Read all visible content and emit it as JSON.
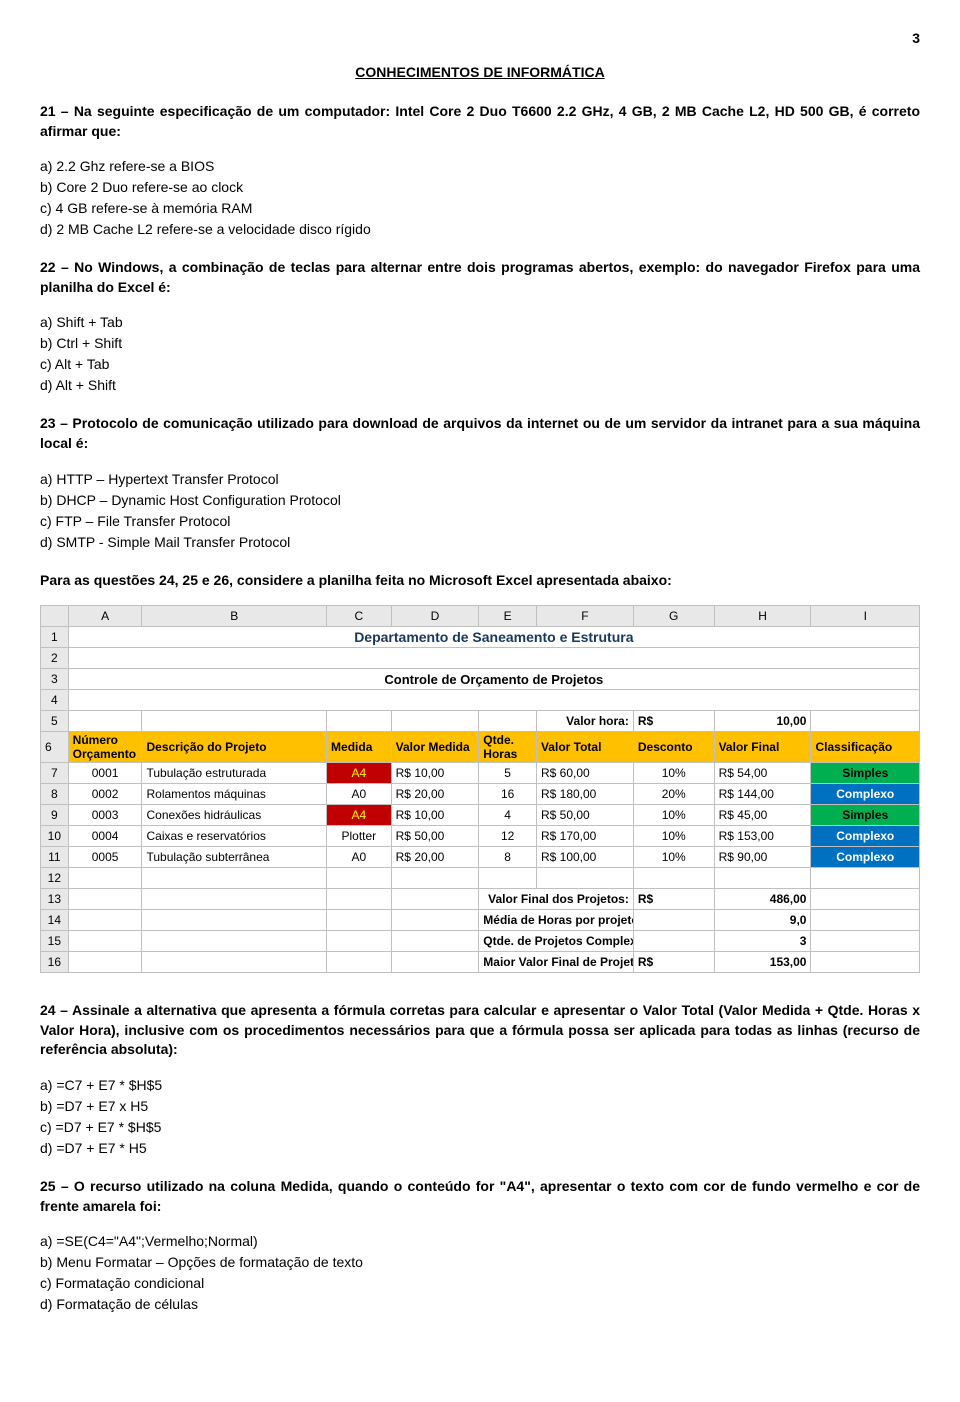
{
  "page_number": "3",
  "section_title": "CONHECIMENTOS DE INFORMÁTICA",
  "q21": {
    "stem": "21 – Na seguinte especificação de um computador: Intel Core 2 Duo T6600 2.2 GHz,  4 GB, 2 MB Cache L2, HD 500 GB, é correto afirmar que:",
    "a": "a)  2.2 Ghz refere-se a BIOS",
    "b": "b)  Core 2 Duo  refere-se ao clock",
    "c": "c)  4 GB refere-se à memória RAM",
    "d": "d)  2 MB Cache L2 refere-se a velocidade disco rígido"
  },
  "q22": {
    "stem": "22 – No Windows, a combinação de teclas para alternar entre dois programas abertos, exemplo: do navegador Firefox para uma planilha do Excel é:",
    "a": "a)  Shift +  Tab",
    "b": "b)  Ctrl   +  Shift",
    "c": "c)  Alt    + Tab",
    "d": "d)  Alt    + Shift"
  },
  "q23": {
    "stem": "23 –  Protocolo de comunicação utilizado para download de arquivos da internet ou de um servidor da intranet para a sua máquina local é:",
    "a": "a)  HTTP – Hypertext Transfer Protocol",
    "b": "b)  DHCP – Dynamic Host Configuration Protocol",
    "c": "c)  FTP – File Transfer Protocol",
    "d": "d)  SMTP - Simple Mail Transfer Protocol"
  },
  "intro_table": "Para as questões 24, 25 e 26, considere a planilha feita no Microsoft Excel apresentada abaixo:",
  "sheet": {
    "cols": [
      "A",
      "B",
      "C",
      "D",
      "E",
      "F",
      "G",
      "H",
      "I"
    ],
    "title1": "Departamento de Saneamento e Estrutura",
    "title2": "Controle de Orçamento de Projetos",
    "valor_hora_label": "Valor hora:",
    "valor_hora_cur": "R$",
    "valor_hora_val": "10,00",
    "headers": {
      "A": "Número Orçamento",
      "B": "Descrição do Projeto",
      "C": "Medida",
      "D": "Valor Medida",
      "E": "Qtde. Horas",
      "F": "Valor Total",
      "G": "Desconto",
      "H": "Valor Final",
      "I": "Classificação"
    },
    "rows": [
      {
        "n": "7",
        "a": "0001",
        "b": "Tubulação estruturada",
        "c": "A4",
        "cred": true,
        "d": "R$    10,00",
        "e": "5",
        "f": "R$     60,00",
        "g": "10%",
        "h": "R$     54,00",
        "i": "Simples",
        "icls": "green"
      },
      {
        "n": "8",
        "a": "0002",
        "b": "Rolamentos máquinas",
        "c": "A0",
        "cred": false,
        "d": "R$    20,00",
        "e": "16",
        "f": "R$   180,00",
        "g": "20%",
        "h": "R$   144,00",
        "i": "Complexo",
        "icls": "blue"
      },
      {
        "n": "9",
        "a": "0003",
        "b": "Conexões hidráulicas",
        "c": "A4",
        "cred": true,
        "d": "R$    10,00",
        "e": "4",
        "f": "R$     50,00",
        "g": "10%",
        "h": "R$     45,00",
        "i": "Simples",
        "icls": "green"
      },
      {
        "n": "10",
        "a": "0004",
        "b": "Caixas e reservatórios",
        "c": "Plotter",
        "cred": false,
        "d": "R$    50,00",
        "e": "12",
        "f": "R$   170,00",
        "g": "10%",
        "h": "R$   153,00",
        "i": "Complexo",
        "icls": "blue"
      },
      {
        "n": "11",
        "a": "0005",
        "b": "Tubulação subterrânea",
        "c": "A0",
        "cred": false,
        "d": "R$    20,00",
        "e": "8",
        "f": "R$   100,00",
        "g": "10%",
        "h": "R$     90,00",
        "i": "Complexo",
        "icls": "blue"
      }
    ],
    "summary": [
      {
        "n": "13",
        "label": "Valor Final dos Projetos:",
        "cur": "R$",
        "val": "486,00"
      },
      {
        "n": "14",
        "label": "Média de Horas por projeto:",
        "cur": "",
        "val": "9,0"
      },
      {
        "n": "15",
        "label": "Qtde. de Projetos Complexos:",
        "cur": "",
        "val": "3"
      },
      {
        "n": "16",
        "label": "Maior Valor Final de Projeto:",
        "cur": "R$",
        "val": "153,00"
      }
    ]
  },
  "q24": {
    "stem": "24 – Assinale a alternativa que apresenta a fórmula corretas para calcular e apresentar o Valor Total (Valor Medida + Qtde. Horas x Valor Hora), inclusive com os procedimentos necessários para que a fórmula possa ser aplicada para todas as linhas (recurso de referência absoluta):",
    "a": "a)   =C7 + E7 * $H$5",
    "b": "b)   =D7 + E7 x H5",
    "c": "c)   =D7 + E7 * $H$5",
    "d": "d)   =D7 + E7 * H5"
  },
  "q25": {
    "stem": "25 – O recurso utilizado na coluna Medida, quando o conteúdo for \"A4\", apresentar o texto com cor de fundo vermelho e cor de frente amarela foi:",
    "a": "a)   =SE(C4=\"A4\";Vermelho;Normal)",
    "b": "b)   Menu Formatar – Opções de formatação de texto",
    "c": "c)   Formatação condicional",
    "d": "d)   Formatação de células"
  }
}
